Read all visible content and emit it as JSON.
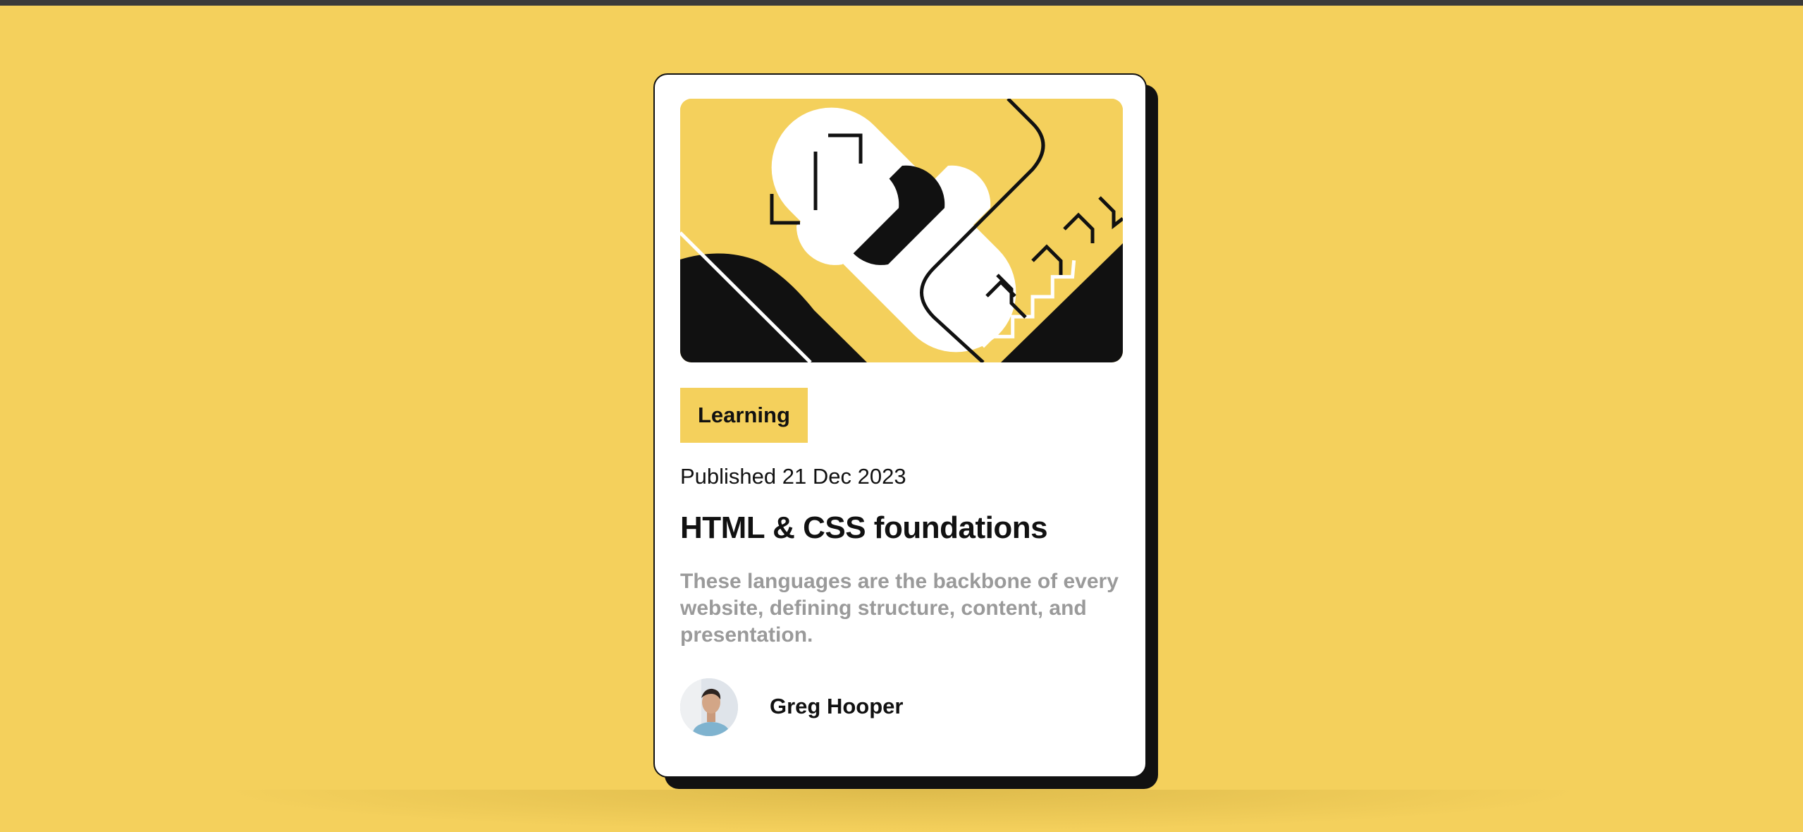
{
  "page": {
    "background_color": "#f4d05c",
    "accent_color": "#f4d05c",
    "text_color": "#111111",
    "muted_text_color": "#9a9a9a"
  },
  "card": {
    "hero_illustration": "abstract-illustration",
    "tag": "Learning",
    "published": "Published 21 Dec 2023",
    "title": "HTML & CSS foundations",
    "description": "These languages are the backbone of every website, defining structure, content, and presentation.",
    "author": {
      "name": "Greg Hooper",
      "avatar_icon": "avatar-photo"
    }
  }
}
